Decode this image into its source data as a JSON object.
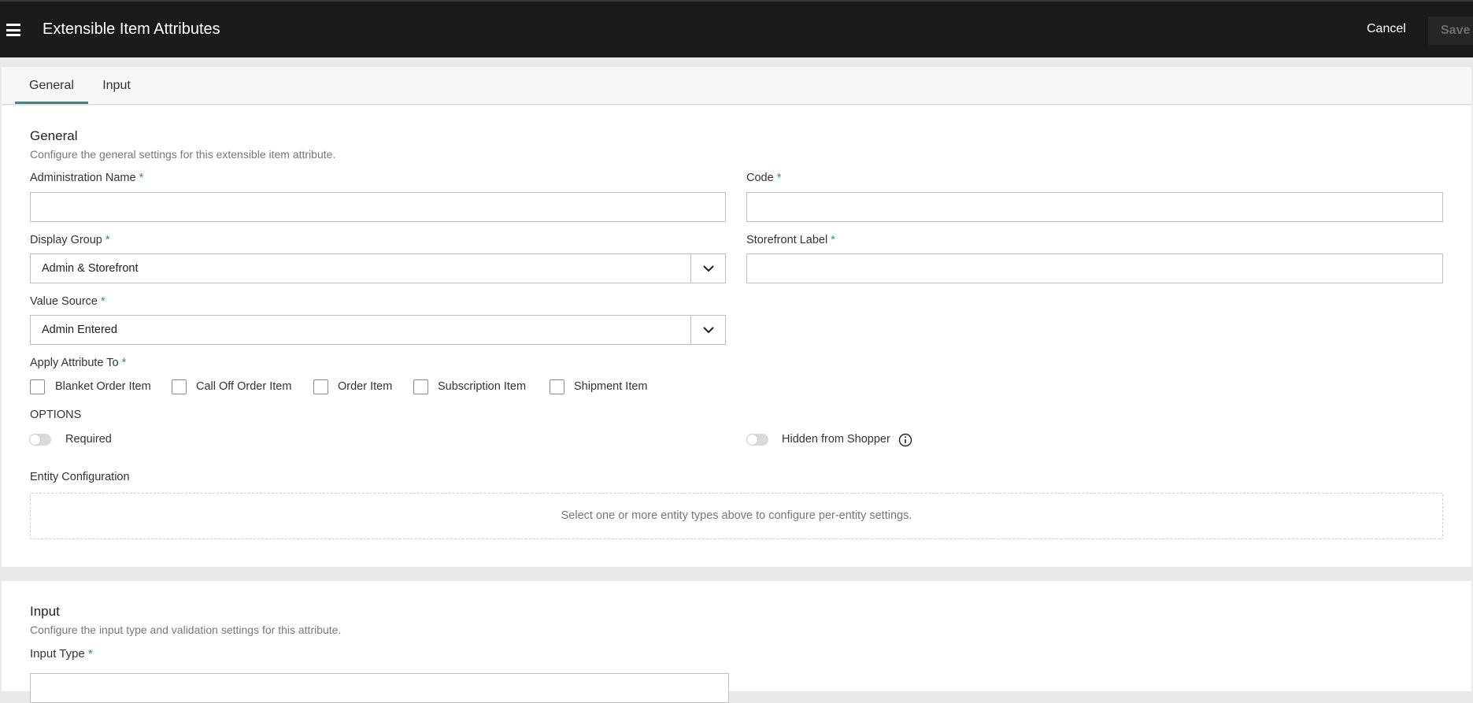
{
  "header": {
    "title": "Extensible Item Attributes",
    "cancel_label": "Cancel",
    "save_label": "Save"
  },
  "tabs": [
    {
      "label": "General",
      "active": true
    },
    {
      "label": "Input",
      "active": false
    }
  ],
  "general": {
    "title": "General",
    "description": "Configure the general settings for this extensible item attribute.",
    "admin_name": {
      "label": "Administration Name",
      "value": ""
    },
    "code": {
      "label": "Code",
      "value": ""
    },
    "display_group": {
      "label": "Display Group",
      "value": "Admin & Storefront"
    },
    "storefront_label": {
      "label": "Storefront Label",
      "value": ""
    },
    "value_source": {
      "label": "Value Source",
      "value": "Admin Entered"
    },
    "apply_to": {
      "label": "Apply Attribute To",
      "options": [
        {
          "label": "Blanket Order Item",
          "checked": false
        },
        {
          "label": "Call Off Order Item",
          "checked": false
        },
        {
          "label": "Order Item",
          "checked": false
        },
        {
          "label": "Subscription Item",
          "checked": false
        },
        {
          "label": "Shipment Item",
          "checked": false
        }
      ]
    },
    "options_heading": "OPTIONS",
    "required_toggle": {
      "label": "Required",
      "on": false
    },
    "hidden_toggle": {
      "label": "Hidden from Shopper",
      "on": false
    },
    "entity_config": {
      "label": "Entity Configuration",
      "empty_text": "Select one or more entity types above to configure per-entity settings."
    },
    "required_marker": "*"
  },
  "input": {
    "title": "Input",
    "description": "Configure the input type and validation settings for this attribute.",
    "input_type": {
      "label": "Input Type",
      "value": ""
    }
  },
  "colors": {
    "accent": "#2b8f8f",
    "topbar": "#1b1b1b"
  },
  "icons": {
    "menu": "hamburger-menu-icon",
    "dropdown": "chevron-down-icon",
    "info": "info-circle-icon"
  }
}
